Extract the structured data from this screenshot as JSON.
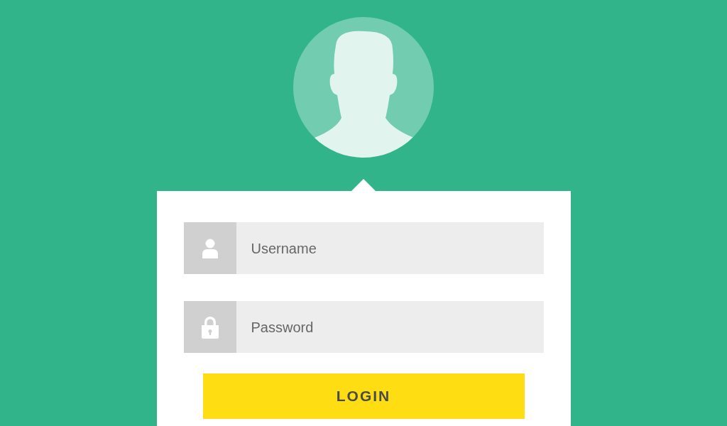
{
  "fields": [
    {
      "kind": "user",
      "placeholder": "Username"
    },
    {
      "kind": "lock",
      "placeholder": "Password"
    }
  ],
  "button": {
    "label": "LOGIN"
  }
}
